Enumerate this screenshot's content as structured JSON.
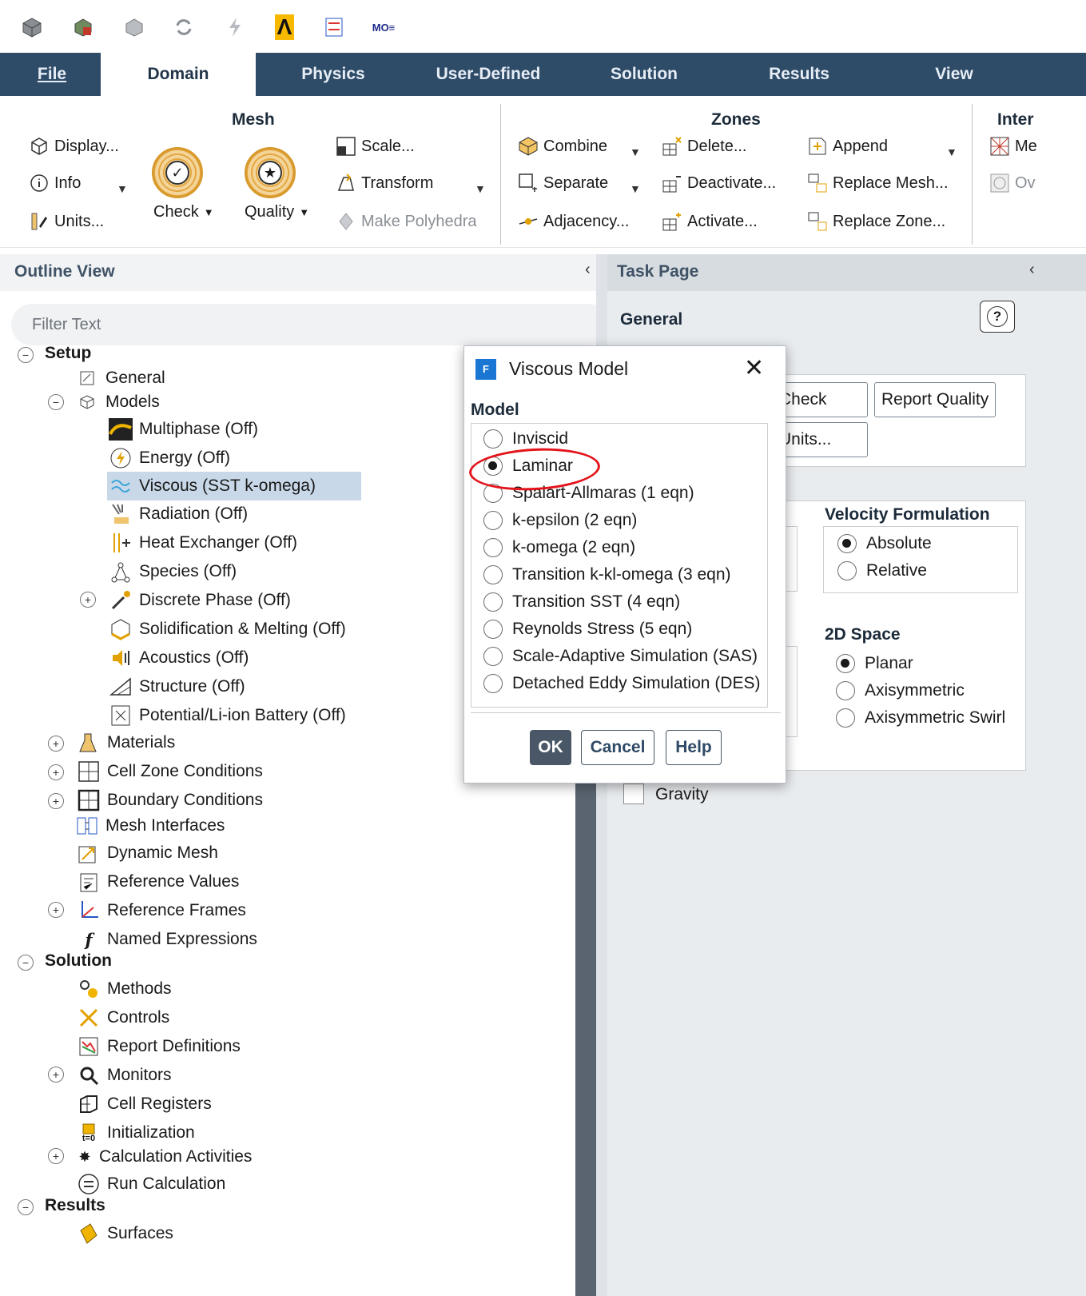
{
  "quick_access": {
    "icons": [
      "mesh-cube-icon",
      "read-case-icon",
      "write-case-icon",
      "refresh-icon",
      "lightning-icon",
      "ansys-logo-icon",
      "compare-icon",
      "parameter-icon"
    ],
    "ansys_glyph": "Λ",
    "mo_glyph": "MO≡"
  },
  "tabs": {
    "file": "File",
    "domain": "Domain",
    "physics": "Physics",
    "user_defined": "User-Defined",
    "solution": "Solution",
    "results": "Results",
    "view": "View"
  },
  "ribbon": {
    "mesh": {
      "title": "Mesh",
      "display": "Display...",
      "info": "Info",
      "units": "Units...",
      "check": "Check",
      "quality": "Quality",
      "scale": "Scale...",
      "transform": "Transform",
      "make_polyhedra": "Make Polyhedra"
    },
    "zones": {
      "title": "Zones",
      "combine": "Combine",
      "separate": "Separate",
      "adjacency": "Adjacency...",
      "delete": "Delete...",
      "deactivate": "Deactivate...",
      "activate": "Activate...",
      "append": "Append",
      "replace_mesh": "Replace Mesh...",
      "replace_zone": "Replace Zone..."
    },
    "interfaces": {
      "title": "Inter",
      "mesh": "Me",
      "overset": "Ov"
    }
  },
  "outline": {
    "title": "Outline View",
    "filter_placeholder": "Filter Text",
    "setup": "Setup",
    "general": "General",
    "models": "Models",
    "multiphase": "Multiphase (Off)",
    "energy": "Energy (Off)",
    "viscous": "Viscous (SST k-omega)",
    "radiation": "Radiation (Off)",
    "heat_exchanger": "Heat Exchanger (Off)",
    "species": "Species (Off)",
    "discrete_phase": "Discrete Phase (Off)",
    "solidification": "Solidification & Melting (Off)",
    "acoustics": "Acoustics (Off)",
    "structure": "Structure (Off)",
    "battery": "Potential/Li-ion Battery (Off)",
    "materials": "Materials",
    "cell_zone": "Cell Zone Conditions",
    "boundary": "Boundary Conditions",
    "mesh_interfaces": "Mesh Interfaces",
    "dynamic_mesh": "Dynamic Mesh",
    "reference_values": "Reference Values",
    "reference_frames": "Reference Frames",
    "named_expressions": "Named Expressions",
    "solution": "Solution",
    "methods": "Methods",
    "controls": "Controls",
    "report_definitions": "Report Definitions",
    "monitors": "Monitors",
    "cell_registers": "Cell Registers",
    "initialization": "Initialization",
    "calculation_activities": "Calculation Activities",
    "run_calculation": "Run Calculation",
    "results": "Results",
    "surfaces": "Surfaces",
    "init_sub": "t=0"
  },
  "task_page": {
    "title": "Task Page",
    "general": "General",
    "help_glyph": "?",
    "check": "Check",
    "report_quality": "Report Quality",
    "units": "Units...",
    "velocity_title": "Velocity Formulation",
    "absolute": "Absolute",
    "relative": "Relative",
    "space_title": "2D Space",
    "planar": "Planar",
    "axisymmetric": "Axisymmetric",
    "axisymmetric_swirl": "Axisymmetric Swirl",
    "gravity": "Gravity"
  },
  "dialog": {
    "logo": "F",
    "title": "Viscous Model",
    "close_glyph": "✕",
    "model_label": "Model",
    "options": [
      "Inviscid",
      "Laminar",
      "Spalart-Allmaras (1 eqn)",
      "k-epsilon (2 eqn)",
      "k-omega (2 eqn)",
      "Transition k-kl-omega (3 eqn)",
      "Transition SST (4 eqn)",
      "Reynolds Stress (5 eqn)",
      "Scale-Adaptive Simulation (SAS)",
      "Detached Eddy Simulation (DES)"
    ],
    "selected": "Laminar",
    "ok": "OK",
    "cancel": "Cancel",
    "help": "Help",
    "annotation_color": "#e3141b"
  },
  "colors": {
    "tab_bar": "#2e4b68",
    "accent": "#4a5766"
  }
}
